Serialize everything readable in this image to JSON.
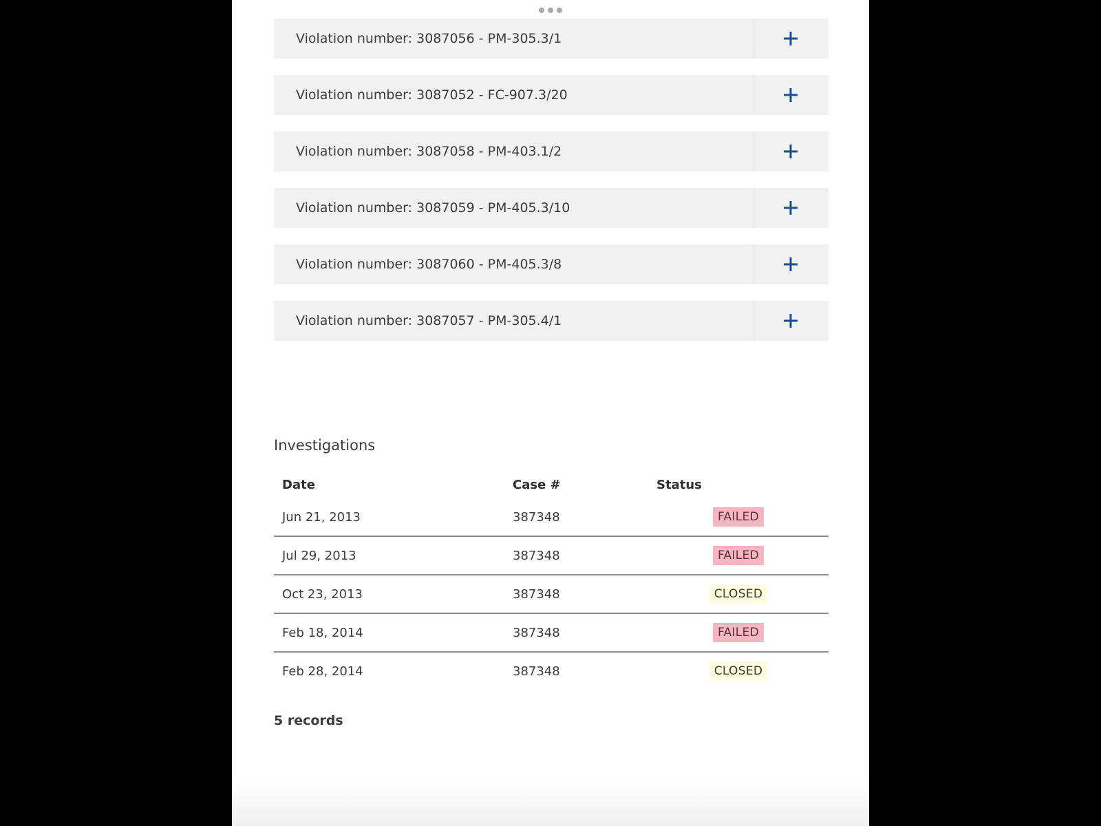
{
  "violations": [
    {
      "label": "Violation number: 3087056 - PM-305.3/1"
    },
    {
      "label": "Violation number: 3087052 - FC-907.3/20"
    },
    {
      "label": "Violation number: 3087058 - PM-403.1/2"
    },
    {
      "label": "Violation number: 3087059 - PM-405.3/10"
    },
    {
      "label": "Violation number: 3087060 - PM-405.3/8"
    },
    {
      "label": "Violation number: 3087057 - PM-305.4/1"
    }
  ],
  "investigations": {
    "title": "Investigations",
    "columns": {
      "date": "Date",
      "case": "Case #",
      "status": "Status"
    },
    "rows": [
      {
        "date": "Jun 21, 2013",
        "case": "387348",
        "status": "FAILED"
      },
      {
        "date": "Jul 29, 2013",
        "case": "387348",
        "status": "FAILED"
      },
      {
        "date": "Oct 23, 2013",
        "case": "387348",
        "status": "CLOSED"
      },
      {
        "date": "Feb 18, 2014",
        "case": "387348",
        "status": "FAILED"
      },
      {
        "date": "Feb 28, 2014",
        "case": "387348",
        "status": "CLOSED"
      }
    ],
    "records_label": "5 records"
  },
  "icons": {
    "expand": "plus-icon",
    "handle": "drag-handle-icon"
  },
  "colors": {
    "accent": "#1f4e8c",
    "failed_bg": "#f7b6c2",
    "closed_bg": "#fdfde0",
    "row_bg": "#f1f1f1"
  }
}
